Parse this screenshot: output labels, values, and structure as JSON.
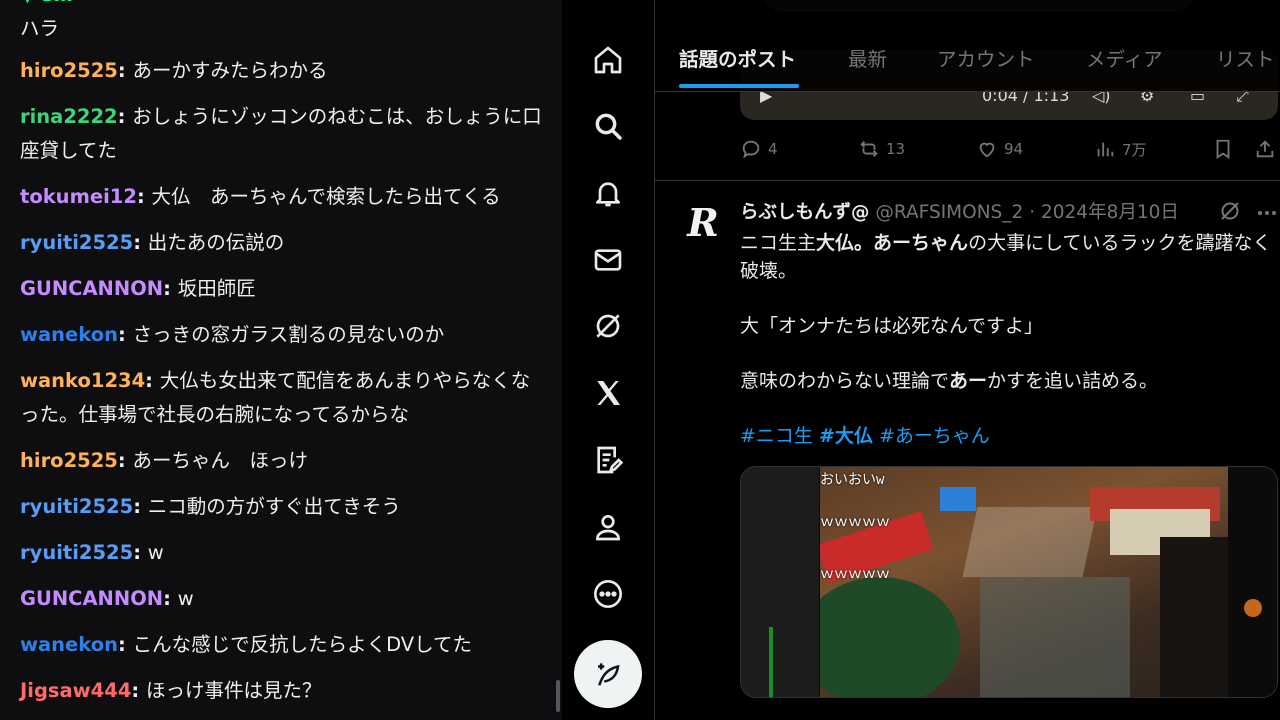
{
  "chat": {
    "top_message": {
      "user": "s...",
      "text": "ハラ"
    },
    "messages": [
      {
        "user": "hiro2525",
        "color": "#ffb05a",
        "text": "あーかすみたらわかる"
      },
      {
        "user": "rina2222",
        "color": "#3ed27b",
        "text": "おしょうにゾッコンのねむこは、おしょうに口座貸してた"
      },
      {
        "user": "tokumei12",
        "color": "#c58cff",
        "text": "大仏　あーちゃんで検索したら出てくる"
      },
      {
        "user": "ryuiti2525",
        "color": "#5b9cf5",
        "text": "出たあの伝説の"
      },
      {
        "user": "GUNCANNON",
        "color": "#c58cff",
        "text": "坂田師匠"
      },
      {
        "user": "wanekon",
        "color": "#2f7fe8",
        "text": "さっきの窓ガラス割るの見ないのか"
      },
      {
        "user": "wanko1234",
        "color": "#ffb05a",
        "text": "大仏も女出来て配信をあんまりやらなくなった。仕事場で社長の右腕になってるからな"
      },
      {
        "user": "hiro2525",
        "color": "#ffb05a",
        "text": "あーちゃん　ほっけ"
      },
      {
        "user": "ryuiti2525",
        "color": "#5b9cf5",
        "text": "ニコ動の方がすぐ出てきそう"
      },
      {
        "user": "ryuiti2525",
        "color": "#5b9cf5",
        "text": "w"
      },
      {
        "user": "GUNCANNON",
        "color": "#c58cff",
        "text": "w"
      },
      {
        "user": "wanekon",
        "color": "#2f7fe8",
        "text": "こんな感じで反抗したらよくDVしてた"
      },
      {
        "user": "Jigsaw444",
        "color": "#ff6b6b",
        "text": "ほっけ事件は見た？"
      }
    ]
  },
  "nav": {
    "icons": [
      "home-icon",
      "explore-icon",
      "notifications-icon",
      "messages-icon",
      "grok-icon",
      "x-premium-icon",
      "lists-icon",
      "profile-icon",
      "more-icon"
    ],
    "post_button": "post-icon"
  },
  "feed": {
    "tabs": [
      {
        "label": "話題のポスト",
        "active": true
      },
      {
        "label": "最新",
        "active": false
      },
      {
        "label": "アカウント",
        "active": false
      },
      {
        "label": "メディア",
        "active": false
      },
      {
        "label": "リスト",
        "active": false
      }
    ],
    "prev_tweet": {
      "video_time": "0:04 / 1:13",
      "replies": "4",
      "reposts": "13",
      "likes": "94",
      "views": "7万"
    },
    "tweet": {
      "avatar_letter": "R",
      "name": "らぶしもんず@",
      "handle": "@RAFSIMONS_2",
      "date": "2024年8月10日",
      "body_line1_a": "ニコ生主",
      "body_line1_b": "大仏",
      "body_line1_c": "。",
      "body_line1_d": "あーちゃん",
      "body_line1_e": "の大事にしているラックを躊躇なく破壊。",
      "body_line2": "大「オンナたちは必死なんですよ」",
      "body_line3_a": "意味のわからない理論で",
      "body_line3_b": "あー",
      "body_line3_c": "かすを追い詰める。",
      "hashtag1": "#ニコ生",
      "hashtag2": "#大仏",
      "hashtag3": "#あーちゃん",
      "video_overlay": [
        "おいおいw",
        "ｗｗｗｗｗ",
        "ｗｗｗｗｗ"
      ]
    }
  }
}
